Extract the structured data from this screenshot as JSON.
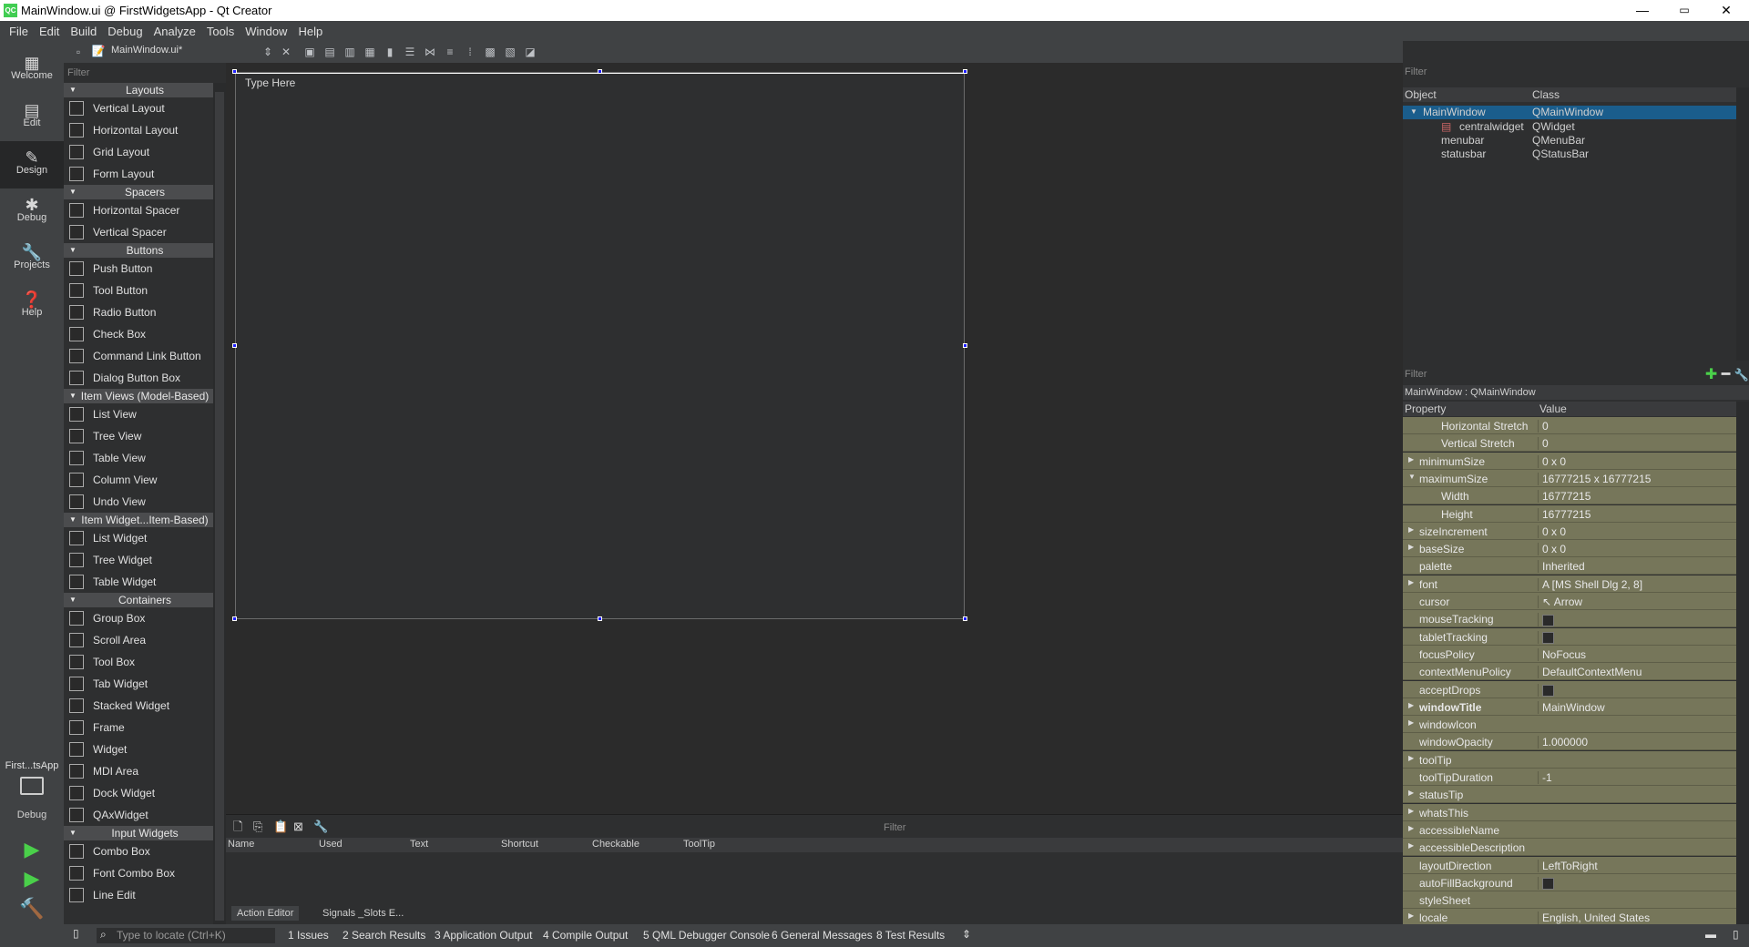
{
  "window": {
    "title": "MainWindow.ui @ FirstWidgetsApp - Qt Creator",
    "app_icon": "QC",
    "minimize": "—",
    "maximize": "▭",
    "close": "✕"
  },
  "menu": [
    "File",
    "Edit",
    "Build",
    "Debug",
    "Analyze",
    "Tools",
    "Window",
    "Help"
  ],
  "modes": [
    {
      "label": "Welcome",
      "icon": "grid-icon"
    },
    {
      "label": "Edit",
      "icon": "document-icon"
    },
    {
      "label": "Design",
      "icon": "pencil-icon"
    },
    {
      "label": "Debug",
      "icon": "bug-icon"
    },
    {
      "label": "Projects",
      "icon": "wrench-icon"
    },
    {
      "label": "Help",
      "icon": "question-icon"
    }
  ],
  "kit": {
    "project": "First...tsApp",
    "label": "Debug"
  },
  "toolbar": {
    "document": "MainWindow.ui*"
  },
  "widgetbox": {
    "filter_placeholder": "Filter",
    "groups": [
      {
        "name": "Layouts",
        "items": [
          "Vertical Layout",
          "Horizontal Layout",
          "Grid Layout",
          "Form Layout"
        ]
      },
      {
        "name": "Spacers",
        "items": [
          "Horizontal Spacer",
          "Vertical Spacer"
        ]
      },
      {
        "name": "Buttons",
        "items": [
          "Push Button",
          "Tool Button",
          "Radio Button",
          "Check Box",
          "Command Link Button",
          "Dialog Button Box"
        ]
      },
      {
        "name": "Item Views (Model-Based)",
        "items": [
          "List View",
          "Tree View",
          "Table View",
          "Column View",
          "Undo View"
        ]
      },
      {
        "name": "Item Widget...Item-Based)",
        "items": [
          "List Widget",
          "Tree Widget",
          "Table Widget"
        ]
      },
      {
        "name": "Containers",
        "items": [
          "Group Box",
          "Scroll Area",
          "Tool Box",
          "Tab Widget",
          "Stacked Widget",
          "Frame",
          "Widget",
          "MDI Area",
          "Dock Widget",
          "QAxWidget"
        ]
      },
      {
        "name": "Input Widgets",
        "items": [
          "Combo Box",
          "Font Combo Box",
          "Line Edit"
        ]
      }
    ]
  },
  "form": {
    "type_here": "Type Here"
  },
  "action_editor": {
    "filter_placeholder": "Filter",
    "columns": [
      "Name",
      "Used",
      "Text",
      "Shortcut",
      "Checkable",
      "ToolTip"
    ],
    "tabs": [
      "Action Editor",
      "Signals _Slots E..."
    ]
  },
  "object_inspector": {
    "filter_placeholder": "Filter",
    "columns": [
      "Object",
      "Class"
    ],
    "rows": [
      {
        "object": "MainWindow",
        "class": "QMainWindow"
      },
      {
        "object": "centralwidget",
        "class": "QWidget"
      },
      {
        "object": "menubar",
        "class": "QMenuBar"
      },
      {
        "object": "statusbar",
        "class": "QStatusBar"
      }
    ]
  },
  "property_editor": {
    "filter_placeholder": "Filter",
    "object_label": "MainWindow : QMainWindow",
    "columns": [
      "Property",
      "Value"
    ],
    "rows": [
      {
        "name": "Horizontal Stretch",
        "value": "0",
        "sub": true
      },
      {
        "name": "Vertical Stretch",
        "value": "0",
        "sub": true
      },
      {
        "name": "minimumSize",
        "value": "0 x 0",
        "expand": "right"
      },
      {
        "name": "maximumSize",
        "value": "16777215 x 16777215",
        "expand": "down"
      },
      {
        "name": "Width",
        "value": "16777215",
        "sub": true
      },
      {
        "name": "Height",
        "value": "16777215",
        "sub": true
      },
      {
        "name": "sizeIncrement",
        "value": "0 x 0",
        "expand": "right"
      },
      {
        "name": "baseSize",
        "value": "0 x 0",
        "expand": "right"
      },
      {
        "name": "palette",
        "value": "Inherited"
      },
      {
        "name": "font",
        "value": "A  [MS Shell Dlg 2, 8]",
        "expand": "right"
      },
      {
        "name": "cursor",
        "value": "↖  Arrow"
      },
      {
        "name": "mouseTracking",
        "value": "",
        "check": true
      },
      {
        "name": "tabletTracking",
        "value": "",
        "check": true
      },
      {
        "name": "focusPolicy",
        "value": "NoFocus"
      },
      {
        "name": "contextMenuPolicy",
        "value": "DefaultContextMenu"
      },
      {
        "name": "acceptDrops",
        "value": "",
        "check": true
      },
      {
        "name": "windowTitle",
        "value": "MainWindow",
        "expand": "right",
        "bold": true
      },
      {
        "name": "windowIcon",
        "value": "",
        "expand": "right"
      },
      {
        "name": "windowOpacity",
        "value": "1.000000"
      },
      {
        "name": "toolTip",
        "value": "",
        "expand": "right"
      },
      {
        "name": "toolTipDuration",
        "value": "-1"
      },
      {
        "name": "statusTip",
        "value": "",
        "expand": "right"
      },
      {
        "name": "whatsThis",
        "value": "",
        "expand": "right"
      },
      {
        "name": "accessibleName",
        "value": "",
        "expand": "right"
      },
      {
        "name": "accessibleDescription",
        "value": "",
        "expand": "right"
      },
      {
        "name": "layoutDirection",
        "value": "LeftToRight"
      },
      {
        "name": "autoFillBackground",
        "value": "",
        "check": true
      },
      {
        "name": "styleSheet",
        "value": ""
      },
      {
        "name": "locale",
        "value": "English, United States",
        "expand": "right"
      }
    ]
  },
  "statusbar": {
    "locate_placeholder": "Type to locate (Ctrl+K)",
    "panes": [
      "1  Issues",
      "2  Search Results",
      "3  Application Output",
      "4  Compile Output",
      "5  QML Debugger Console",
      "6  General Messages",
      "8  Test Results"
    ]
  }
}
